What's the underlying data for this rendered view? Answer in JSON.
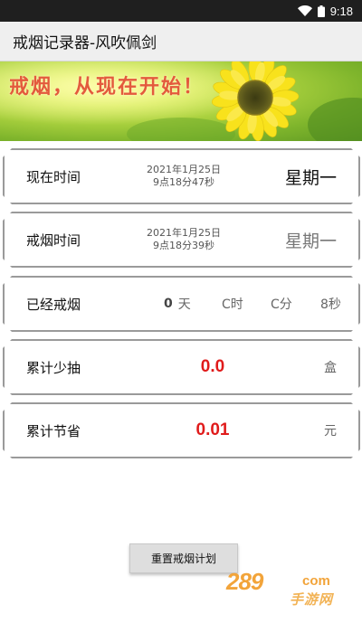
{
  "status_bar": {
    "time": "9:18"
  },
  "app": {
    "title": "戒烟记录器-风吹佩剑"
  },
  "banner": {
    "slogan": "戒烟，从现在开始！"
  },
  "rows": {
    "now": {
      "label": "现在时间",
      "date": "2021年1月25日",
      "time": "9点18分47秒",
      "weekday": "星期一"
    },
    "quit": {
      "label": "戒烟时间",
      "date": "2021年1月25日",
      "time": "9点18分39秒",
      "weekday": "星期一"
    },
    "elapsed": {
      "label": "已经戒烟",
      "days_value": "0",
      "days_unit": "天",
      "hours": "C时",
      "minutes": "C分",
      "seconds": "8秒"
    },
    "packs": {
      "label": "累计少抽",
      "value": "0.0",
      "unit": "盒"
    },
    "savings": {
      "label": "累计节省",
      "value": "0.01",
      "unit": "元"
    }
  },
  "actions": {
    "reset_label": "重置戒烟计划"
  },
  "watermark": {
    "domain": "289",
    "tld": "com",
    "site_name": "手游网"
  },
  "colors": {
    "accent_red": "#e01b1b",
    "banner_text": "#e35a3c",
    "watermark": "#f2a43a"
  },
  "icons": {
    "status_wifi": "wifi-icon",
    "status_battery": "battery-icon"
  }
}
